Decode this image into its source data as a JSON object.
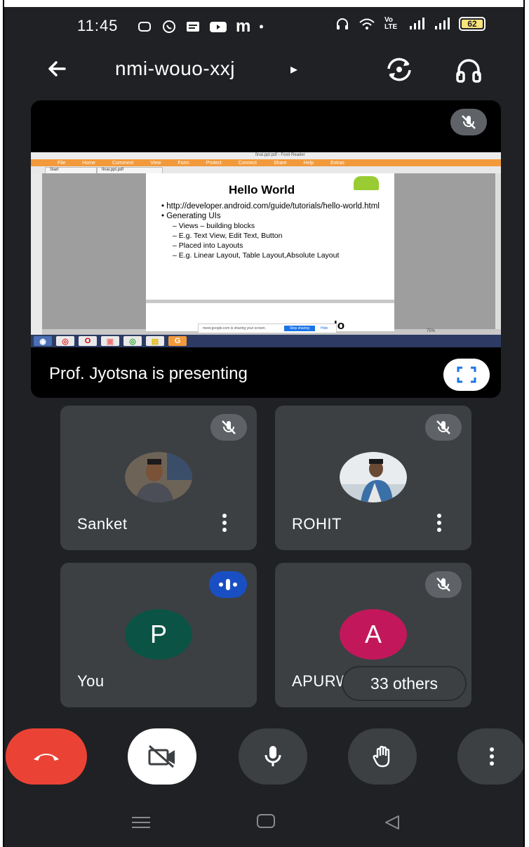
{
  "status_bar": {
    "time": "11:45",
    "left_icons": [
      "message-icon",
      "whatsapp-icon",
      "news-icon",
      "youtube-icon",
      "m-icon",
      "dot-icon"
    ],
    "right_icons": [
      "headset-icon",
      "wifi-icon",
      "volte-icon",
      "signal-icon",
      "signal-icon"
    ],
    "volte_label": "Vo LTE",
    "battery_level": "62"
  },
  "top_bar": {
    "meeting_code": "nmi-wouo-xxj",
    "title_arrow": "▸"
  },
  "presentation": {
    "presenter_label": "Prof. Jyotsna is presenting",
    "shared_screen": {
      "window_title": "final.ppt.pdf - Foxit Reader",
      "menu": [
        "File",
        "Home",
        "Comment",
        "View",
        "Form",
        "Protect",
        "Connect",
        "Share",
        "Help",
        "Extras"
      ],
      "tabs": [
        "Start",
        "final.ppt.pdf"
      ],
      "slide_title": "Hello World",
      "bullets": [
        {
          "level": 1,
          "text": "http://developer.android.com/guide/tutorials/hello-world.html"
        },
        {
          "level": 1,
          "text": "Generating UIs"
        },
        {
          "level": 2,
          "text": "Views – building blocks"
        },
        {
          "level": 2,
          "text": "E.g. Text View, Edit Text, Button"
        },
        {
          "level": 2,
          "text": "Placed into Layouts"
        },
        {
          "level": 2,
          "text": "E.g. Linear Layout, Table Layout,Absolute Layout"
        }
      ],
      "next_slide_fragment": "lo",
      "share_bar_text": "meet.google.com is sharing your screen.",
      "stop_sharing": "Stop sharing",
      "hide": "Hide",
      "zoom": "75%"
    }
  },
  "participants": [
    {
      "name": "Sanket",
      "muted": true,
      "avatar": "photo"
    },
    {
      "name": "ROHIT",
      "muted": true,
      "avatar": "photo"
    },
    {
      "name": "You",
      "muted": false,
      "speaking": true,
      "avatar_letter": "P",
      "avatar_color": "#0b5345"
    },
    {
      "name": "APURW",
      "muted": true,
      "avatar_letter": "A",
      "avatar_color": "#c2185b"
    }
  ],
  "others_chip": "33 others",
  "colors": {
    "background": "#202124",
    "tile": "#3c4043",
    "end_call": "#ea4335",
    "speaking": "#1a4fc4"
  }
}
